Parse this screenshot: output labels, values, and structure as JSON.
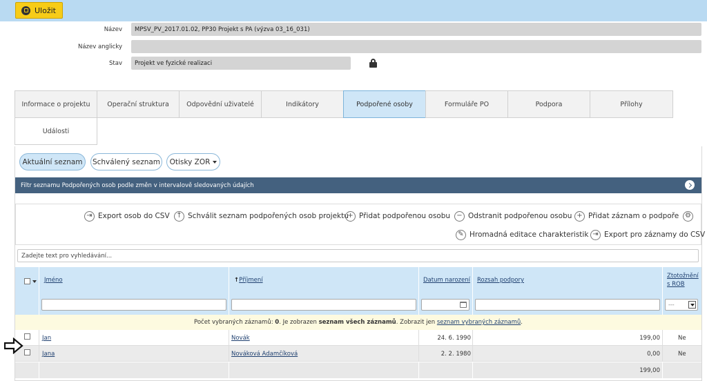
{
  "toolbar": {
    "save_label": "Uložit"
  },
  "form": {
    "name_label": "Název",
    "name_value": "MPSV_PV_2017.01.02, PP30 Projekt s PA (výzva 03_16_031)",
    "name_en_label": "Název anglicky",
    "name_en_value": "",
    "status_label": "Stav",
    "status_value": "Projekt ve fyzické realizaci"
  },
  "tabs": [
    "Informace o projektu",
    "Operační struktura",
    "Odpovědní uživatelé",
    "Indikátory",
    "Podpořené osoby",
    "Formuláře PO",
    "Podpora",
    "Přílohy",
    "Události"
  ],
  "list_buttons": {
    "current": "Aktuální seznam",
    "approved": "Schválený seznam",
    "snapshots": "Otisky ZOR"
  },
  "filter_bar": "Filtr seznamu Podpořených osob podle změn v intervalově sledovaných údajích",
  "actions": {
    "export_csv": "Export osob do CSV",
    "approve": "Schválit seznam podpořených osob projektu",
    "add_person": "Přidat podpořenou osobu",
    "remove_person": "Odstranit podpořenou osobu",
    "add_record": "Přidat záznam o podpoře",
    "bulk_edit": "Hromadná editace charakteristik",
    "export_records": "Export pro záznamy do CSV"
  },
  "search": {
    "placeholder": "Zadejte text pro vyhledávání..."
  },
  "columns": {
    "first_name": "Jméno",
    "last_name": "Příjmení",
    "birth_date": "Datum narození",
    "support_scope": "Rozsah podpory",
    "identification_1": "Ztotožnění",
    "identification_2": "s ROB"
  },
  "filter_select": "---",
  "info": {
    "part1": "Počet vybraných záznamů: ",
    "count": "0",
    "part2": ". Je zobrazen ",
    "all": "seznam všech záznamů",
    "part3": ". Zobrazit jen ",
    "link": "seznam vybraných záznamů",
    "part4": "."
  },
  "rows": [
    {
      "first_name": "Jan",
      "last_name": "Novák",
      "birth_date": "24. 6. 1990",
      "support": "199,00",
      "identified": "Ne"
    },
    {
      "first_name": "Jana",
      "last_name": "Nováková Adamčíková",
      "birth_date": "2. 2. 1980",
      "support": "0,00",
      "identified": "Ne"
    }
  ],
  "total": "199,00"
}
